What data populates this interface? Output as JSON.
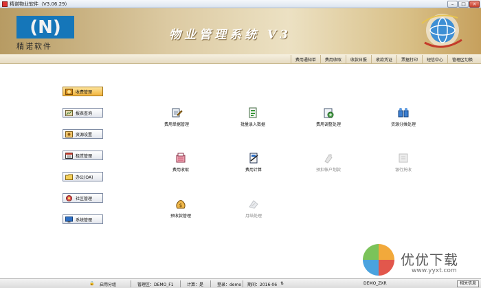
{
  "window": {
    "title": "精诺物业软件（V3.06.29）"
  },
  "banner": {
    "logo_mark": "(N)",
    "logo_text": "精诺软件",
    "system_title": "物业管理系统 V3"
  },
  "topnav": {
    "items": [
      "费用通知单",
      "费用收取",
      "收款日报",
      "收款凭证",
      "票据打印",
      "短信中心",
      "管理区切换"
    ]
  },
  "sidebar": {
    "items": [
      {
        "label": "收费管理",
        "icon": "coins-icon",
        "active": true
      },
      {
        "label": "报表查询",
        "icon": "report-icon"
      },
      {
        "label": "资源设置",
        "icon": "settings-icon"
      },
      {
        "label": "租赁管理",
        "icon": "calendar-icon"
      },
      {
        "label": "办公(OA)",
        "icon": "folder-icon"
      },
      {
        "label": "社区管理",
        "icon": "community-icon"
      },
      {
        "label": "系统管理",
        "icon": "monitor-icon"
      }
    ]
  },
  "functions": [
    {
      "label": "费用单据管理",
      "icon": "documents-icon",
      "enabled": true
    },
    {
      "label": "批量录入数据",
      "icon": "batch-input-icon",
      "enabled": true
    },
    {
      "label": "费用调整处理",
      "icon": "adjust-icon",
      "enabled": true
    },
    {
      "label": "资源分摊处理",
      "icon": "allocation-icon",
      "enabled": true
    },
    {
      "label": "费用收取",
      "icon": "cash-register-icon",
      "enabled": true
    },
    {
      "label": "费用计算",
      "icon": "calculate-icon",
      "enabled": true
    },
    {
      "label": "预扣帐户划款",
      "icon": "transfer-icon",
      "enabled": false
    },
    {
      "label": "银行托收",
      "icon": "bank-icon",
      "enabled": false
    },
    {
      "label": "预收款管理",
      "icon": "money-bag-icon",
      "enabled": true
    },
    {
      "label": "月结处理",
      "icon": "month-close-icon",
      "enabled": false
    }
  ],
  "statusbar": {
    "grouping": "启用分组",
    "area": "管理区：DEMO_F1",
    "calc": "计算：是",
    "login": "登录：demo",
    "period": "期间：2016-06",
    "code": "DEMO_ZXR",
    "info_button": "相关信息"
  },
  "watermark": {
    "text": "优优下载",
    "url": "www.yyxt.com"
  },
  "colors": {
    "logo_blue": "#1576b9",
    "banner_gold": "#d8bf86",
    "active_nav": "#f3b43d"
  }
}
